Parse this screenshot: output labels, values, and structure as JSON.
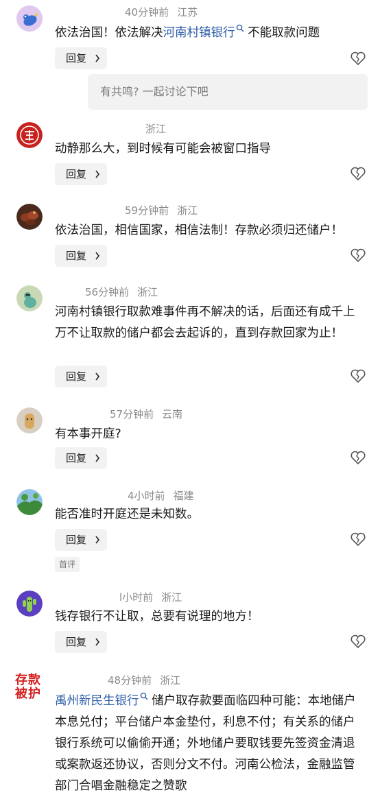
{
  "comments": [
    {
      "time": "40分钟前",
      "region": "江苏",
      "text_before": "依法治国！依法解决",
      "link": "河南村镇银行",
      "text_after": "不能取款问题",
      "reply_label": "回复",
      "sub_reply": "有共鸣? 一起讨论下吧"
    },
    {
      "time": "",
      "region": "浙江",
      "text": "动静那么大，到时候有可能会被窗口指导",
      "reply_label": "回复"
    },
    {
      "time": "59分钟前",
      "region": "浙江",
      "text": "依法治国，相信国家，相信法制！存款必须归还储户！",
      "reply_label": "回复"
    },
    {
      "time": "56分钟前",
      "region": "浙江",
      "text": "河南村镇银行取款难事件再不解决的话，后面还有成千上万不让取款的储户都会去起诉的，直到存款回家为止！",
      "reply_label": "回复"
    },
    {
      "time": "57分钟前",
      "region": "云南",
      "text": "有本事开庭?",
      "reply_label": "回复"
    },
    {
      "time": "4小时前",
      "region": "福建",
      "text": "能否准时开庭还是未知数。",
      "reply_label": "回复",
      "badge": "首评"
    },
    {
      "time": "l小时前",
      "region": "浙江",
      "text": "钱存银行不让取，总要有说理的地方！",
      "reply_label": "回复"
    },
    {
      "time": "48分钟前",
      "region": "浙江",
      "avatar_text": "存款被护",
      "link": "禹州新民生银行",
      "text_after": "储户取存款要面临四种可能：本地储户本息兑付；平台储户本金垫付，利息不付；有关系的储户银行系统可以偷偷开通；外地储户要取钱要先签资金清退或案款返还协议，否则分文不付。河南公检法，金融监管部门合唱金融稳定之赞歌"
    }
  ],
  "colors": {
    "link": "#2f5ea8",
    "meta": "#8a8a8a",
    "button_bg": "#f2f2f2"
  },
  "icons": {
    "heart": "broken-heart-icon",
    "chevron": "chevron-right-icon",
    "search": "search-icon"
  }
}
